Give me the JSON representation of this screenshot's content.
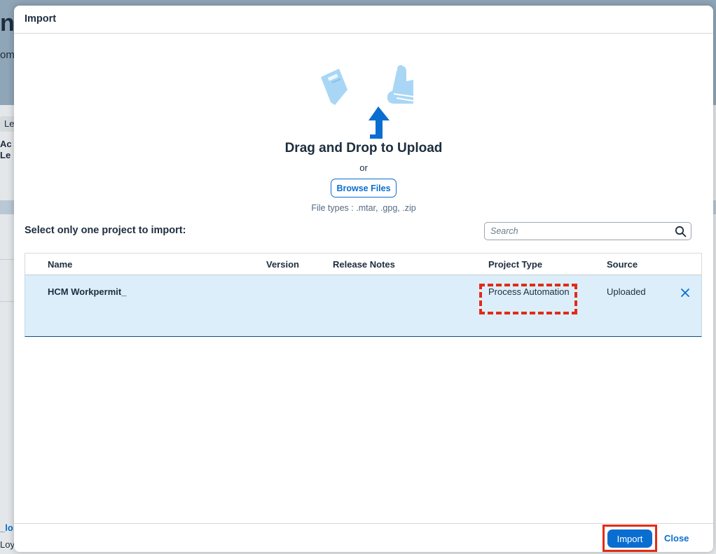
{
  "background": {
    "title_fragment": "ne",
    "subtitle_fragment": "om",
    "tag_fragment": "Le",
    "bold_fragment_1": "Ac",
    "bold_fragment_2": "Le",
    "link_fragment": "_lo",
    "muted_fragment": "Loy"
  },
  "dialog": {
    "title": "Import",
    "upload": {
      "title": "Drag and Drop to Upload",
      "or": "or",
      "browse_label": "Browse Files",
      "file_types": "File types : .mtar, .gpg, .zip"
    },
    "section_title": "Select only one project to import:",
    "search": {
      "placeholder": "Search",
      "value": ""
    },
    "table": {
      "columns": [
        "Name",
        "Version",
        "Release Notes",
        "Project Type",
        "Source"
      ],
      "rows": [
        {
          "name": "HCM Workpermit_",
          "version": "",
          "release_notes": "",
          "project_type": "Process Automation",
          "source": "Uploaded",
          "selected": true
        }
      ]
    },
    "footer": {
      "import_label": "Import",
      "close_label": "Close"
    }
  },
  "colors": {
    "accent": "#0a6ed1",
    "selected_row": "#dbeefa",
    "annotation_red": "#e32b17",
    "text": "#1d2d3e"
  },
  "icons": {
    "upload_arrow": "arrow-up-icon",
    "search": "search-icon",
    "remove": "close-icon",
    "illustration": "upload-illustration"
  }
}
